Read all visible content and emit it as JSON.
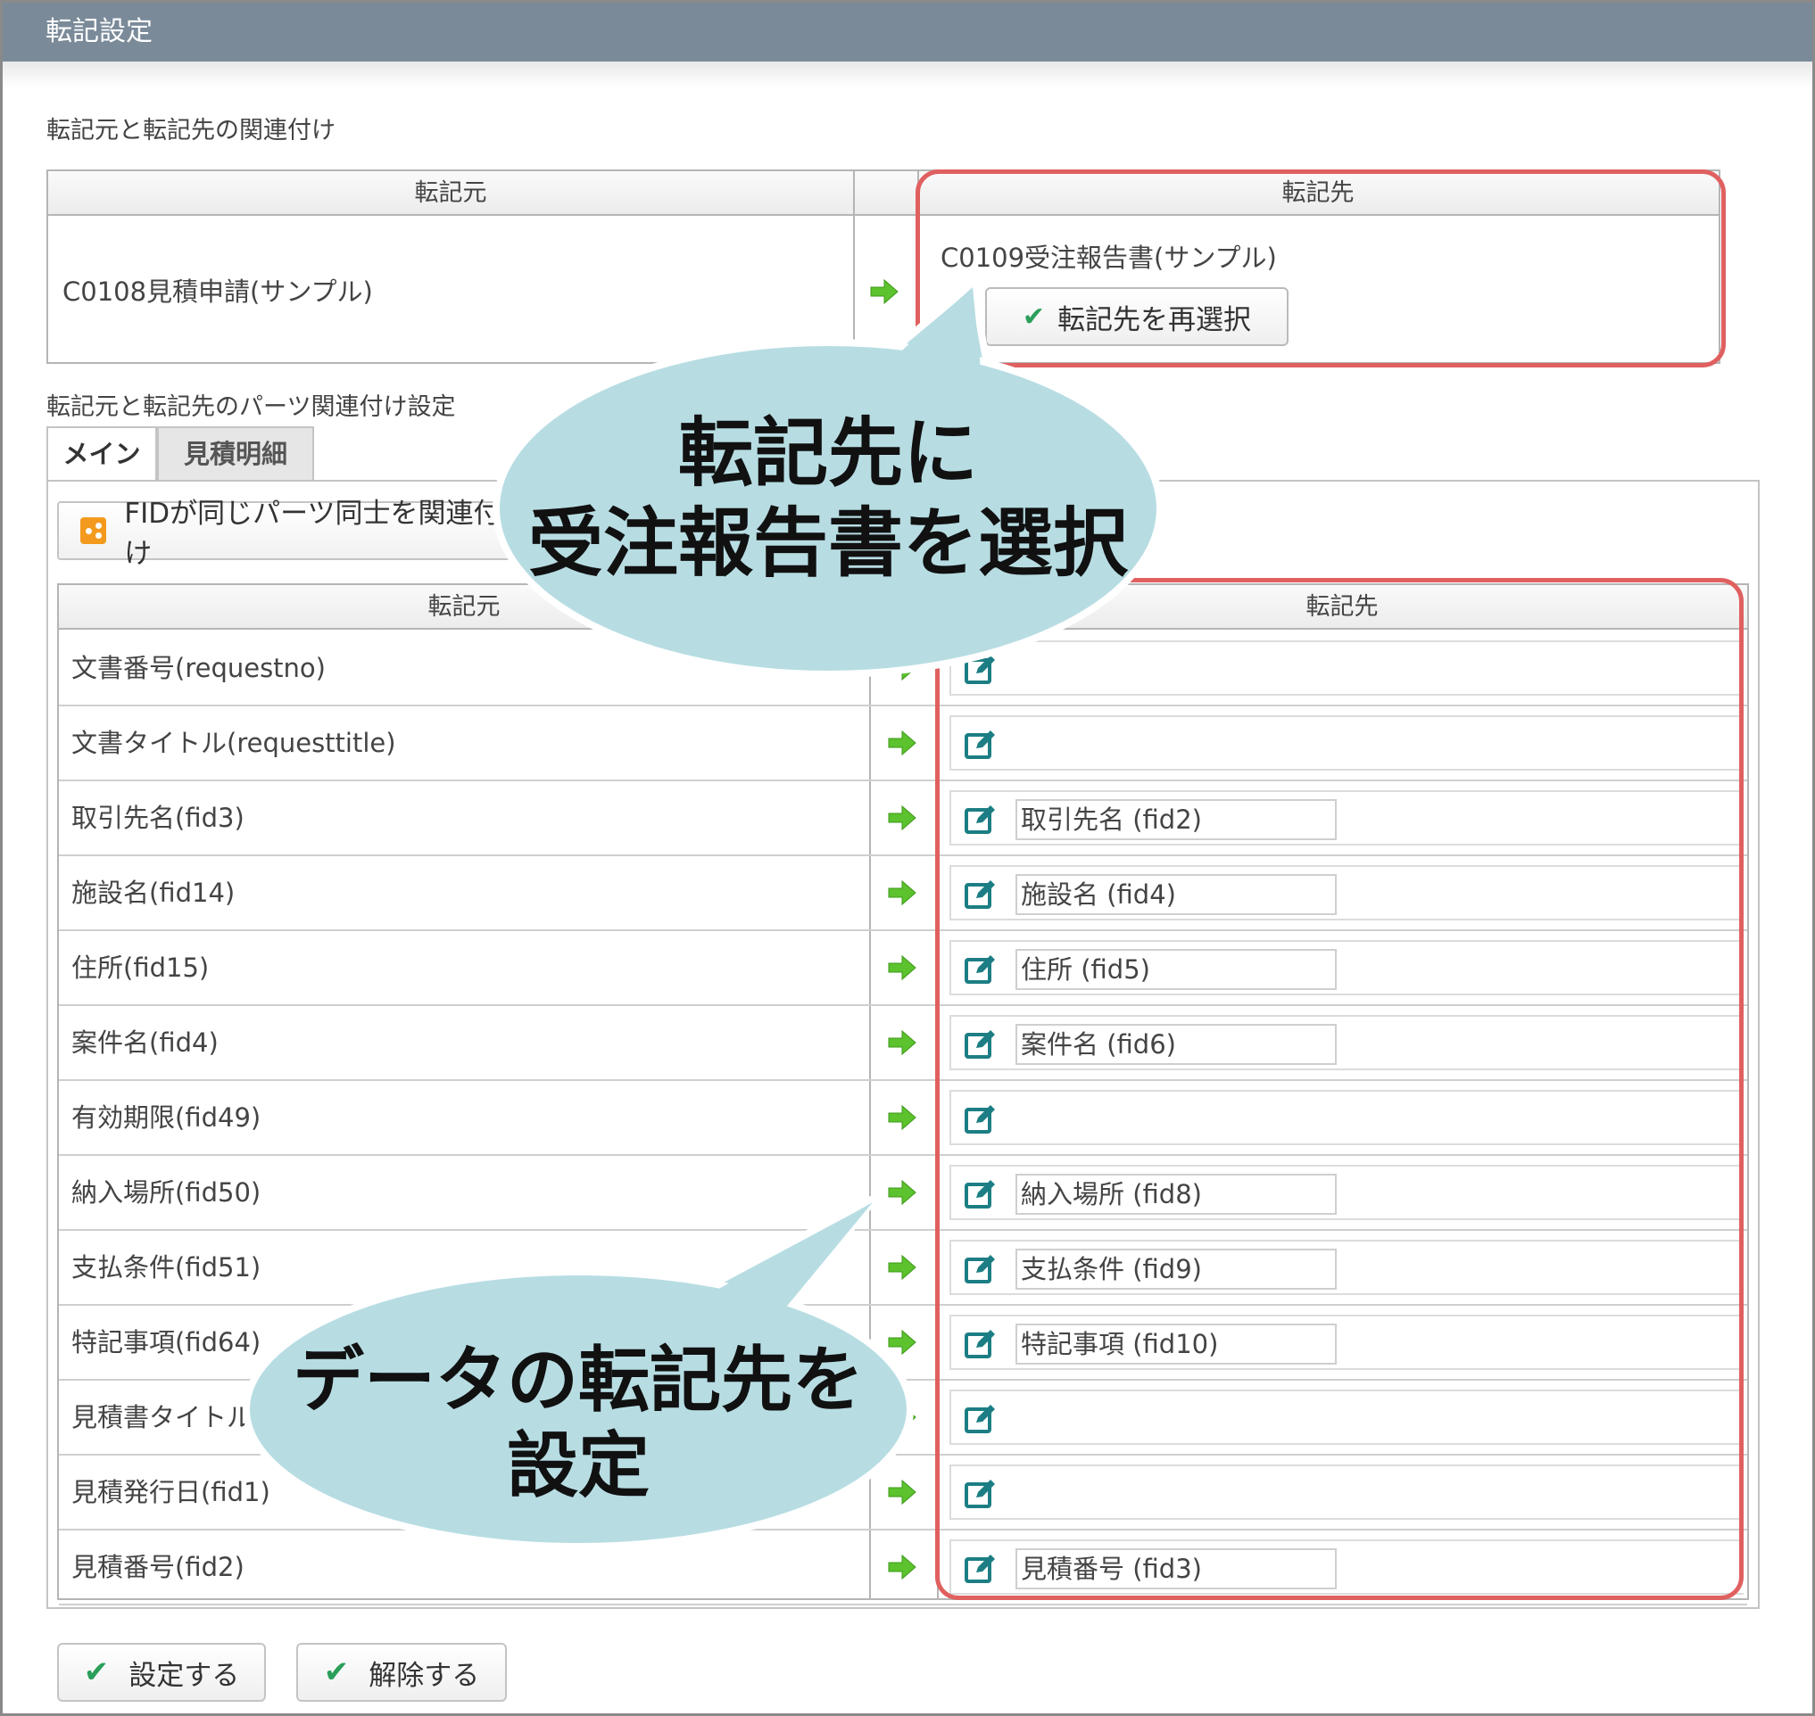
{
  "window": {
    "title": "転記設定"
  },
  "section1": {
    "label": "転記元と転記先の関連付け",
    "header_source": "転記元",
    "header_dest": "転記先",
    "source_name": "C0108見積申請(サンプル)",
    "dest_name": "C0109受注報告書(サンプル)",
    "reselect_label": "転記先を再選択"
  },
  "section2": {
    "label": "転記元と転記先のパーツ関連付け設定",
    "tabs": [
      {
        "label": "メイン",
        "active": true
      },
      {
        "label": "見積明細",
        "active": false
      }
    ],
    "fid_button": "FIDが同じパーツ同士を関連付け",
    "header_source": "転記元",
    "header_dest": "転記先",
    "rows": [
      {
        "source": "文書番号(requestno)",
        "dest": ""
      },
      {
        "source": "文書タイトル(requesttitle)",
        "dest": ""
      },
      {
        "source": "取引先名(fid3)",
        "dest": "取引先名 (fid2)"
      },
      {
        "source": "施設名(fid14)",
        "dest": "施設名 (fid4)"
      },
      {
        "source": "住所(fid15)",
        "dest": "住所 (fid5)"
      },
      {
        "source": "案件名(fid4)",
        "dest": "案件名 (fid6)"
      },
      {
        "source": "有効期限(fid49)",
        "dest": ""
      },
      {
        "source": "納入場所(fid50)",
        "dest": "納入場所 (fid8)"
      },
      {
        "source": "支払条件(fid51)",
        "dest": "支払条件 (fid9)"
      },
      {
        "source": "特記事項(fid64)",
        "dest": "特記事項 (fid10)"
      },
      {
        "source": "見積書タイトル",
        "dest": ""
      },
      {
        "source": "見積発行日(fid1)",
        "dest": ""
      },
      {
        "source": "見積番号(fid2)",
        "dest": "見積番号 (fid3)"
      }
    ]
  },
  "buttons": {
    "apply": "設定する",
    "release": "解除する"
  },
  "callouts": {
    "top_line1": "転記先に",
    "top_line2": "受注報告書を選択",
    "bottom_line1": "データの転記先を",
    "bottom_line2": "設定"
  },
  "colors": {
    "titlebar": "#7a8a99",
    "highlight": "#e06060",
    "callout": "#b7dde3",
    "arrow": "#5cc22d",
    "edit_icon": "#1c7e84"
  },
  "icons": {
    "arrow": "right-arrow-icon",
    "edit": "edit-icon",
    "check": "check-icon",
    "share": "share-icon"
  }
}
